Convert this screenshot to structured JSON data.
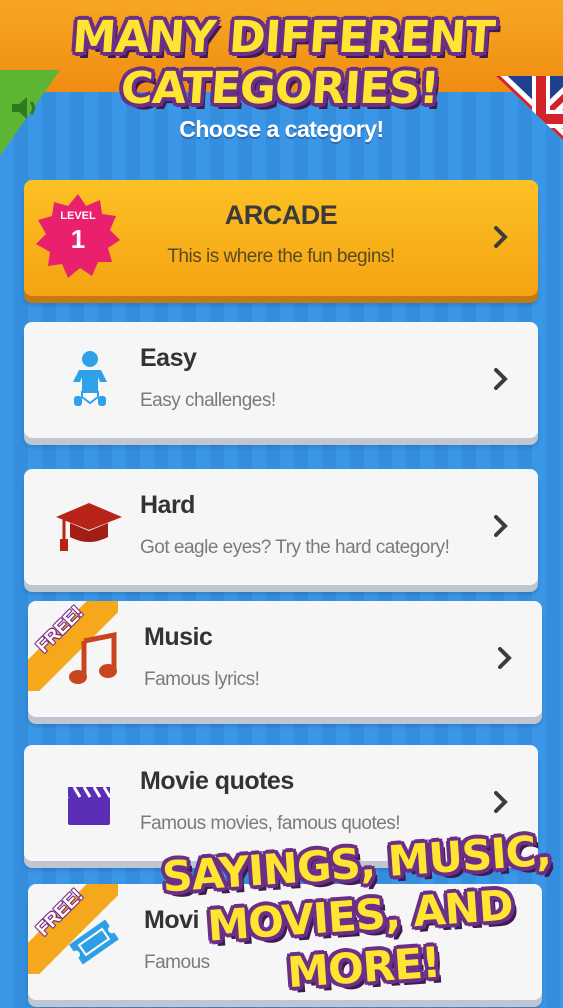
{
  "banner": {
    "headline": "MANY DIFFERENT CATEGORIES!"
  },
  "header": {
    "subtitle": "Choose a category!"
  },
  "categories": [
    {
      "title": "ARCADE",
      "desc": "This is where the fun begins!",
      "level_label": "LEVEL",
      "level_num": "1",
      "icon": "level-badge-icon"
    },
    {
      "title": "Easy",
      "desc": "Easy challenges!",
      "icon": "baby-icon"
    },
    {
      "title": "Hard",
      "desc": "Got eagle eyes? Try the hard category!",
      "icon": "graduation-cap-icon"
    },
    {
      "title": "Music",
      "desc": "Famous lyrics!",
      "icon": "music-note-icon",
      "ribbon": "FREE!"
    },
    {
      "title": "Movie quotes",
      "desc": "Famous movies, famous quotes!",
      "icon": "clapperboard-icon"
    },
    {
      "title": "Movi",
      "desc": "Famous",
      "icon": "ticket-icon",
      "ribbon": "FREE!"
    }
  ],
  "promo": {
    "line1": "SAYINGS, MUSIC,",
    "line2": "MOVIES, AND MORE!"
  },
  "colors": {
    "accent": "#f5a312",
    "background": "#3a96e6",
    "banner_text": "#ffe431",
    "banner_outline": "#6a2f86"
  }
}
